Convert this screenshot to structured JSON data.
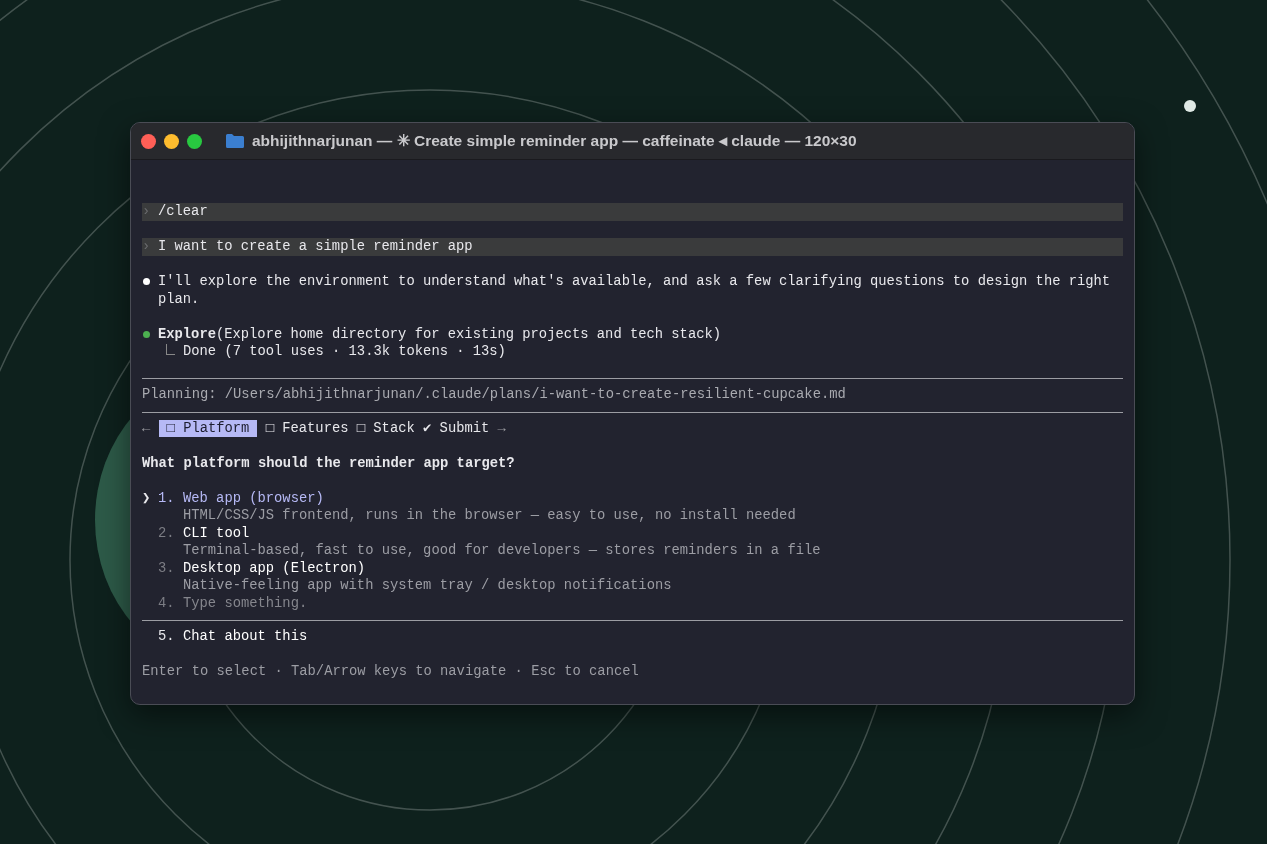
{
  "window": {
    "title": "abhijithnarjunan — ✳ Create simple reminder app — caffeinate ◂ claude — 120×30"
  },
  "transcript": [
    {
      "kind": "command",
      "symbol": "›",
      "text": "/clear"
    },
    {
      "kind": "command",
      "symbol": "›",
      "text": "I want to create a simple reminder app"
    },
    {
      "kind": "message",
      "color": "#ffffff",
      "text": "I'll explore the environment to understand what's available, and ask a few clarifying questions to design the right plan."
    },
    {
      "kind": "tool",
      "color": "#4caf50",
      "name": "Explore",
      "args": "(Explore home directory for existing projects and tech stack)",
      "result": "Done (7 tool uses · 13.3k tokens · 13s)"
    }
  ],
  "plan_path": "Planning: /Users/abhijithnarjunan/.claude/plans/i-want-to-create-resilient-cupcake.md",
  "tabs": {
    "prev": "←",
    "next": "→",
    "items": [
      {
        "label": "□ Platform",
        "selected": true
      },
      {
        "label": "□ Features",
        "selected": false
      },
      {
        "label": "□ Stack",
        "selected": false
      },
      {
        "label": "✔ Submit",
        "selected": false
      }
    ]
  },
  "question": "What platform should the reminder app target?",
  "pointer": "❯",
  "options": [
    {
      "kind": "choice",
      "number": "1.",
      "label": "Web app (browser)",
      "description": "HTML/CSS/JS frontend, runs in the browser — easy to use, no install needed",
      "selected": true
    },
    {
      "kind": "choice",
      "number": "2.",
      "label": "CLI tool",
      "description": "Terminal-based, fast to use, good for developers — stores reminders in a file",
      "selected": false
    },
    {
      "kind": "choice",
      "number": "3.",
      "label": "Desktop app (Electron)",
      "description": "Native-feeling app with system tray / desktop notifications",
      "selected": false
    },
    {
      "kind": "input",
      "number": "4.",
      "placeholder": "Type something.",
      "selected": false
    }
  ],
  "extra_option": {
    "number": "5.",
    "label": "Chat about this",
    "selected": false
  },
  "hint": "Enter to select · Tab/Arrow keys to navigate · Esc to cancel"
}
